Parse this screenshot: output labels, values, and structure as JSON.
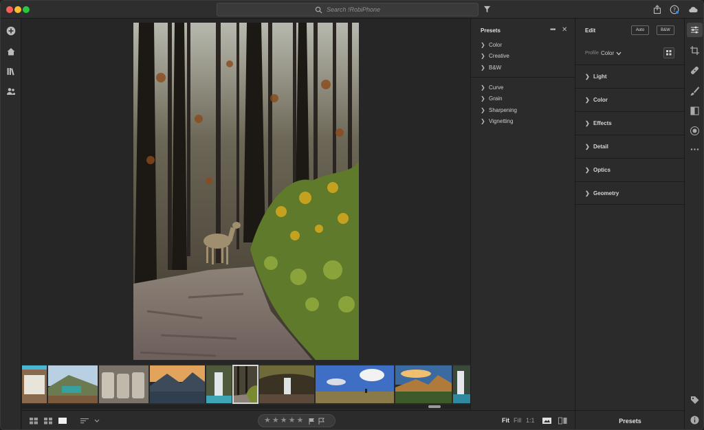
{
  "search": {
    "placeholder": "Search !RobiPhone"
  },
  "presets_panel": {
    "title": "Presets",
    "group_one": [
      {
        "label": "Color"
      },
      {
        "label": "Creative"
      },
      {
        "label": "B&W"
      }
    ],
    "group_two": [
      {
        "label": "Curve"
      },
      {
        "label": "Grain"
      },
      {
        "label": "Sharpening"
      },
      {
        "label": "Vignetting"
      }
    ]
  },
  "edit_panel": {
    "title": "Edit",
    "auto_label": "Auto",
    "bw_label": "B&W",
    "profile_label": "Profile",
    "profile_value": "Color",
    "sections": [
      {
        "label": "Light"
      },
      {
        "label": "Color"
      },
      {
        "label": "Effects"
      },
      {
        "label": "Detail"
      },
      {
        "label": "Optics"
      },
      {
        "label": "Geometry"
      }
    ],
    "footer_label": "Presets"
  },
  "bottom_bar": {
    "zoom_fit": "Fit",
    "zoom_fill": "Fill",
    "zoom_one": "1:1",
    "stars": [
      "★",
      "★",
      "★",
      "★",
      "★"
    ]
  },
  "filmstrip": {
    "selected_index": 5,
    "thumbnails": [
      {
        "name": "sign-detail"
      },
      {
        "name": "mountain-sign"
      },
      {
        "name": "sacks"
      },
      {
        "name": "mountain-lake"
      },
      {
        "name": "waterfall-rocks"
      },
      {
        "name": "forest-deer"
      },
      {
        "name": "cascade"
      },
      {
        "name": "meadow-sky"
      },
      {
        "name": "alpine-sunset"
      },
      {
        "name": "falls-edge"
      }
    ]
  },
  "colors": {
    "accent": "#d9d9d9",
    "panel_bg": "#2b2b2b",
    "viewer_bg": "#262626"
  }
}
